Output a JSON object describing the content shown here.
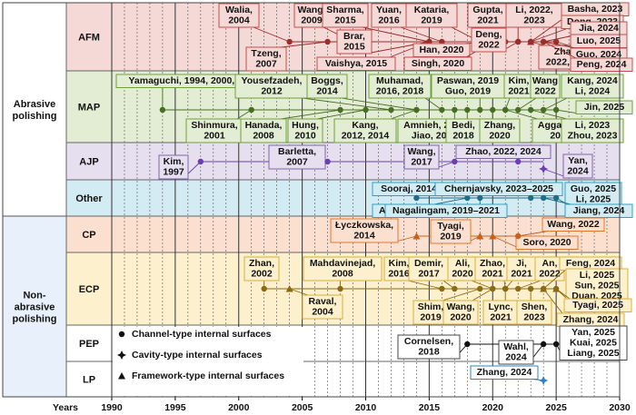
{
  "axis": {
    "caption": "Years",
    "years": [
      "1990",
      "1995",
      "2000",
      "2005",
      "2010",
      "2015",
      "2020",
      "2025",
      "2030"
    ]
  },
  "groups": [
    {
      "id": "abrasive",
      "label_lines": [
        "Abrasive",
        "polishing"
      ]
    },
    {
      "id": "non_abrasive",
      "label_lines": [
        "Non-",
        "abrasive",
        "polishing"
      ]
    }
  ],
  "legend": {
    "items": [
      {
        "shape": "circle",
        "text": "Channel-type internal surfaces"
      },
      {
        "shape": "star",
        "text": "Cavity-type internal surfaces"
      },
      {
        "shape": "triangle",
        "text": "Framework-type internal surfaces"
      }
    ]
  },
  "rows": [
    {
      "id": "afm",
      "name": "AFM",
      "fill": "#f4d9d6",
      "stroke": "#c0504d",
      "color": "#9b2d2a",
      "entries": [
        {
          "text": [
            "Walia,",
            "2004"
          ],
          "year": 2004,
          "shape": "circle"
        },
        {
          "text": [
            "Tzeng,",
            "2007"
          ],
          "year": 2007,
          "shape": "circle"
        },
        {
          "text": [
            "Wang,",
            "2009"
          ],
          "year": 2009,
          "shape": "circle"
        },
        {
          "text": [
            "Sharma,",
            "2015"
          ],
          "year": 2015,
          "shape": "circle"
        },
        {
          "text": [
            "Brar,",
            "2015"
          ],
          "year": 2015,
          "shape": "circle"
        },
        {
          "text": [
            "Vaishya, 2015"
          ],
          "year": 2015,
          "shape": "circle"
        },
        {
          "text": [
            "Yuan,",
            "2016"
          ],
          "year": 2016,
          "shape": "circle"
        },
        {
          "text": [
            "Kataria,",
            "2019"
          ],
          "year": 2019,
          "shape": "circle"
        },
        {
          "text": [
            "Han, 2020"
          ],
          "year": 2020,
          "shape": "circle"
        },
        {
          "text": [
            "Singh, 2020"
          ],
          "year": 2020,
          "shape": "circle"
        },
        {
          "text": [
            "Gupta,",
            "2021"
          ],
          "year": 2021,
          "shape": "circle"
        },
        {
          "text": [
            "Deng,",
            "2022"
          ],
          "year": 2022,
          "shape": "circle"
        },
        {
          "text": [
            "Li, 2022,",
            "2023"
          ],
          "year": 2022,
          "shape": "circle"
        },
        {
          "text": [
            "Zhang,",
            "2022, 2023"
          ],
          "year": 2023,
          "shape": "triangle"
        },
        {
          "text": [
            "Basha, 2023"
          ],
          "year": 2023,
          "shape": "circle"
        },
        {
          "text": [
            "Dong, 2023"
          ],
          "year": 2023,
          "shape": "circle"
        },
        {
          "text": [
            "Jia, 2024"
          ],
          "year": 2024,
          "shape": "circle"
        },
        {
          "text": [
            "Luo, 2025"
          ],
          "year": 2025,
          "shape": "circle"
        },
        {
          "text": [
            "Guo, 2024"
          ],
          "year": 2024,
          "shape": "circle"
        },
        {
          "text": [
            "Peng, 2024"
          ],
          "year": 2024,
          "shape": "circle"
        }
      ]
    },
    {
      "id": "map",
      "name": "MAP",
      "fill": "#e3edd3",
      "stroke": "#70a03c",
      "color": "#4a6d26",
      "entries": [
        {
          "text": [
            "Yamaguchi, 1994, 2000, 2001"
          ],
          "year": 1994,
          "shape": "circle"
        },
        {
          "text": [
            "Shinmura,",
            "2001"
          ],
          "year": 2001,
          "shape": "circle"
        },
        {
          "text": [
            "Hanada,",
            "2008"
          ],
          "year": 2008,
          "shape": "circle"
        },
        {
          "text": [
            "Yousefzadeh,",
            "2012"
          ],
          "year": 2012,
          "shape": "circle"
        },
        {
          "text": [
            "Hung,",
            "2010"
          ],
          "year": 2010,
          "shape": "circle"
        },
        {
          "text": [
            "Kang,",
            "2012, 2014"
          ],
          "year": 2014,
          "shape": "circle"
        },
        {
          "text": [
            "Boggs,",
            "2014"
          ],
          "year": 2014,
          "shape": "circle"
        },
        {
          "text": [
            "Muhamad,",
            "2016, 2018"
          ],
          "year": 2016,
          "shape": "circle"
        },
        {
          "text": [
            "Amnieh, 2017",
            "Jiao, 2017"
          ],
          "year": 2017,
          "shape": "circle"
        },
        {
          "text": [
            "Paswan, 2019",
            "Guo, 2019"
          ],
          "year": 2019,
          "shape": "circle"
        },
        {
          "text": [
            "Bedi,",
            "2018"
          ],
          "year": 2018,
          "shape": "circle"
        },
        {
          "text": [
            "Zhang,",
            "2020"
          ],
          "year": 2020,
          "shape": "circle"
        },
        {
          "text": [
            "Kim,",
            "2021"
          ],
          "year": 2021,
          "shape": "circle"
        },
        {
          "text": [
            "Wang",
            "2022"
          ],
          "year": 2022,
          "shape": "circle"
        },
        {
          "text": [
            "Aggarwal,",
            "2021"
          ],
          "year": 2021,
          "shape": "circle"
        },
        {
          "text": [
            "Kang, 2024",
            "Li, 2024"
          ],
          "year": 2024,
          "shape": "circle"
        },
        {
          "text": [
            "Jin, 2025"
          ],
          "year": 2025,
          "shape": "circle"
        },
        {
          "text": [
            "Li, 2023",
            "Zhou, 2023"
          ],
          "year": 2023,
          "shape": "circle"
        }
      ]
    },
    {
      "id": "ajp",
      "name": "AJP",
      "fill": "#e6dff0",
      "stroke": "#8064a2",
      "color": "#6a3fb0",
      "entries": [
        {
          "text": [
            "Kim,",
            "1997"
          ],
          "year": 1997,
          "shape": "circle"
        },
        {
          "text": [
            "Barletta,",
            "2007"
          ],
          "year": 2007,
          "shape": "circle"
        },
        {
          "text": [
            "Wang,",
            "2017"
          ],
          "year": 2017,
          "shape": "circle"
        },
        {
          "text": [
            "Zhao, 2022, 2024"
          ],
          "year": 2022,
          "shape": "circle"
        },
        {
          "text": [
            "Yan,",
            "2024"
          ],
          "year": 2024,
          "shape": "star"
        }
      ]
    },
    {
      "id": "other",
      "name": "Other",
      "fill": "#d3ebf2",
      "stroke": "#31a0c0",
      "color": "#1e6e86",
      "entries": [
        {
          "text": [
            "Sooraj, 2014"
          ],
          "year": 2014,
          "shape": "circle"
        },
        {
          "text": [
            "Azami, 2018"
          ],
          "year": 2018,
          "shape": "circle"
        },
        {
          "text": [
            "Chernjavsky, 2023–2025"
          ],
          "year": 2023,
          "shape": "circle"
        },
        {
          "text": [
            "Nagalingam, 2019–2021"
          ],
          "year": 2019,
          "shape": "circle"
        },
        {
          "text": [
            "Guo, 2025",
            "Li, 2025"
          ],
          "year": 2025,
          "shape": "circle"
        },
        {
          "text": [
            "Jiang, 2024"
          ],
          "year": 2024,
          "shape": "circle"
        }
      ]
    },
    {
      "id": "cp",
      "name": "CP",
      "fill": "#fbe0cf",
      "stroke": "#e07830",
      "color": "#c8601e",
      "entries": [
        {
          "text": [
            "Łyczkowska,",
            "2014"
          ],
          "year": 2014,
          "shape": "triangle"
        },
        {
          "text": [
            "Tyagi,",
            "2019"
          ],
          "year": 2019,
          "shape": "triangle"
        },
        {
          "text": [
            "Soro, 2020"
          ],
          "year": 2020,
          "shape": "triangle"
        },
        {
          "text": [
            "Wang, 2022"
          ],
          "year": 2022,
          "shape": "circle"
        }
      ]
    },
    {
      "id": "ecp",
      "name": "ECP",
      "fill": "#fdf0cc",
      "stroke": "#d9b13a",
      "color": "#8a6a12",
      "entries": [
        {
          "text": [
            "Zhan,",
            "2002"
          ],
          "year": 2002,
          "shape": "circle"
        },
        {
          "text": [
            "Raval,",
            "2004"
          ],
          "year": 2004,
          "shape": "triangle"
        },
        {
          "text": [
            "Mahdavinejad,",
            "2008"
          ],
          "year": 2008,
          "shape": "circle"
        },
        {
          "text": [
            "Kim,",
            "2016"
          ],
          "year": 2016,
          "shape": "circle"
        },
        {
          "text": [
            "Demir,",
            "2017"
          ],
          "year": 2017,
          "shape": "circle"
        },
        {
          "text": [
            "Ali,",
            "2020"
          ],
          "year": 2020,
          "shape": "circle"
        },
        {
          "text": [
            "Zhao,",
            "2021"
          ],
          "year": 2021,
          "shape": "circle"
        },
        {
          "text": [
            "Ji,",
            "2021"
          ],
          "year": 2021,
          "shape": "circle"
        },
        {
          "text": [
            "An,",
            "2022"
          ],
          "year": 2022,
          "shape": "circle"
        },
        {
          "text": [
            "Shim,",
            "2019"
          ],
          "year": 2019,
          "shape": "circle"
        },
        {
          "text": [
            "Wang,",
            "2020"
          ],
          "year": 2020,
          "shape": "circle"
        },
        {
          "text": [
            "Lync,",
            "2021"
          ],
          "year": 2021,
          "shape": "circle"
        },
        {
          "text": [
            "Shen,",
            "2023"
          ],
          "year": 2023,
          "shape": "circle"
        },
        {
          "text": [
            "Feng, 2024"
          ],
          "year": 2024,
          "shape": "circle"
        },
        {
          "text": [
            "Li, 2025",
            "Sun, 2025",
            "Duan, 2025"
          ],
          "year": 2025,
          "shape": "circle"
        },
        {
          "text": [
            "Tyagi, 2025"
          ],
          "year": 2025,
          "shape": "triangle"
        },
        {
          "text": [
            "Zhang, 2024"
          ],
          "year": 2024,
          "shape": "triangle"
        }
      ]
    },
    {
      "id": "pep",
      "name": "PEP",
      "fill": "#ffffff",
      "stroke": "#444444",
      "color": "#111111",
      "entries": [
        {
          "text": [
            "Cornelsen,",
            "2018"
          ],
          "year": 2018,
          "shape": "circle"
        },
        {
          "text": [
            "Wahl,",
            "2024"
          ],
          "year": 2024,
          "shape": "circle"
        },
        {
          "text": [
            "Yan, 2025",
            "Kuai, 2025",
            "Liang, 2025"
          ],
          "year": 2025,
          "shape": "circle"
        }
      ]
    },
    {
      "id": "lp",
      "name": "LP",
      "fill": "#ffffff",
      "stroke": "#2e86c1",
      "color": "#2e86c1",
      "entries": [
        {
          "text": [
            "Zhang, 2024"
          ],
          "year": 2024,
          "shape": "star"
        }
      ]
    }
  ]
}
